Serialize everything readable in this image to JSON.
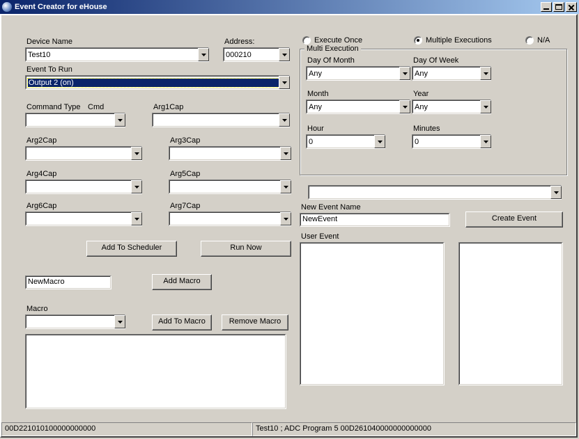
{
  "window": {
    "title": "Event Creator for eHouse"
  },
  "labels": {
    "device_name": "Device Name",
    "address": "Address:",
    "event_to_run": "Event To Run",
    "command_type": "Command Type",
    "cmd": "Cmd",
    "arg1": "Arg1Cap",
    "arg2": "Arg2Cap",
    "arg3": "Arg3Cap",
    "arg4": "Arg4Cap",
    "arg5": "Arg5Cap",
    "arg6": "Arg6Cap",
    "arg7": "Arg7Cap",
    "macro": "Macro",
    "new_event_name": "New Event Name",
    "user_event": "User Event"
  },
  "values": {
    "device_name": "Test10",
    "address": "000210",
    "event_to_run": "Output 2 (on)",
    "command_type": "",
    "cmd": "",
    "arg1": "",
    "arg2": "",
    "arg3": "",
    "arg4": "",
    "arg5": "",
    "arg6": "",
    "arg7": "",
    "new_macro": "NewMacro",
    "macro": "",
    "new_event_name": "NewEvent",
    "extra_combo": ""
  },
  "buttons": {
    "add_to_scheduler": "Add To Scheduler",
    "run_now": "Run Now",
    "add_macro": "Add Macro",
    "add_to_macro": "Add To Macro",
    "remove_macro": "Remove Macro",
    "create_event": "Create Event"
  },
  "exec": {
    "execute_once": "Execute Once",
    "multiple_executions": "Multiple Executions",
    "na": "N/A",
    "selected": "multiple"
  },
  "multi": {
    "legend": "Multi Execution",
    "day_of_month_label": "Day Of Month",
    "day_of_month": "Any",
    "day_of_week_label": "Day Of Week",
    "day_of_week": "Any",
    "month_label": "Month",
    "month": "Any",
    "year_label": "Year",
    "year": "Any",
    "hour_label": "Hour",
    "hour": "0",
    "minutes_label": "Minutes",
    "minutes": "0"
  },
  "status": {
    "left": "00D221010100000000000",
    "right": "Test10 ; ADC Program 5 00D261040000000000000"
  }
}
